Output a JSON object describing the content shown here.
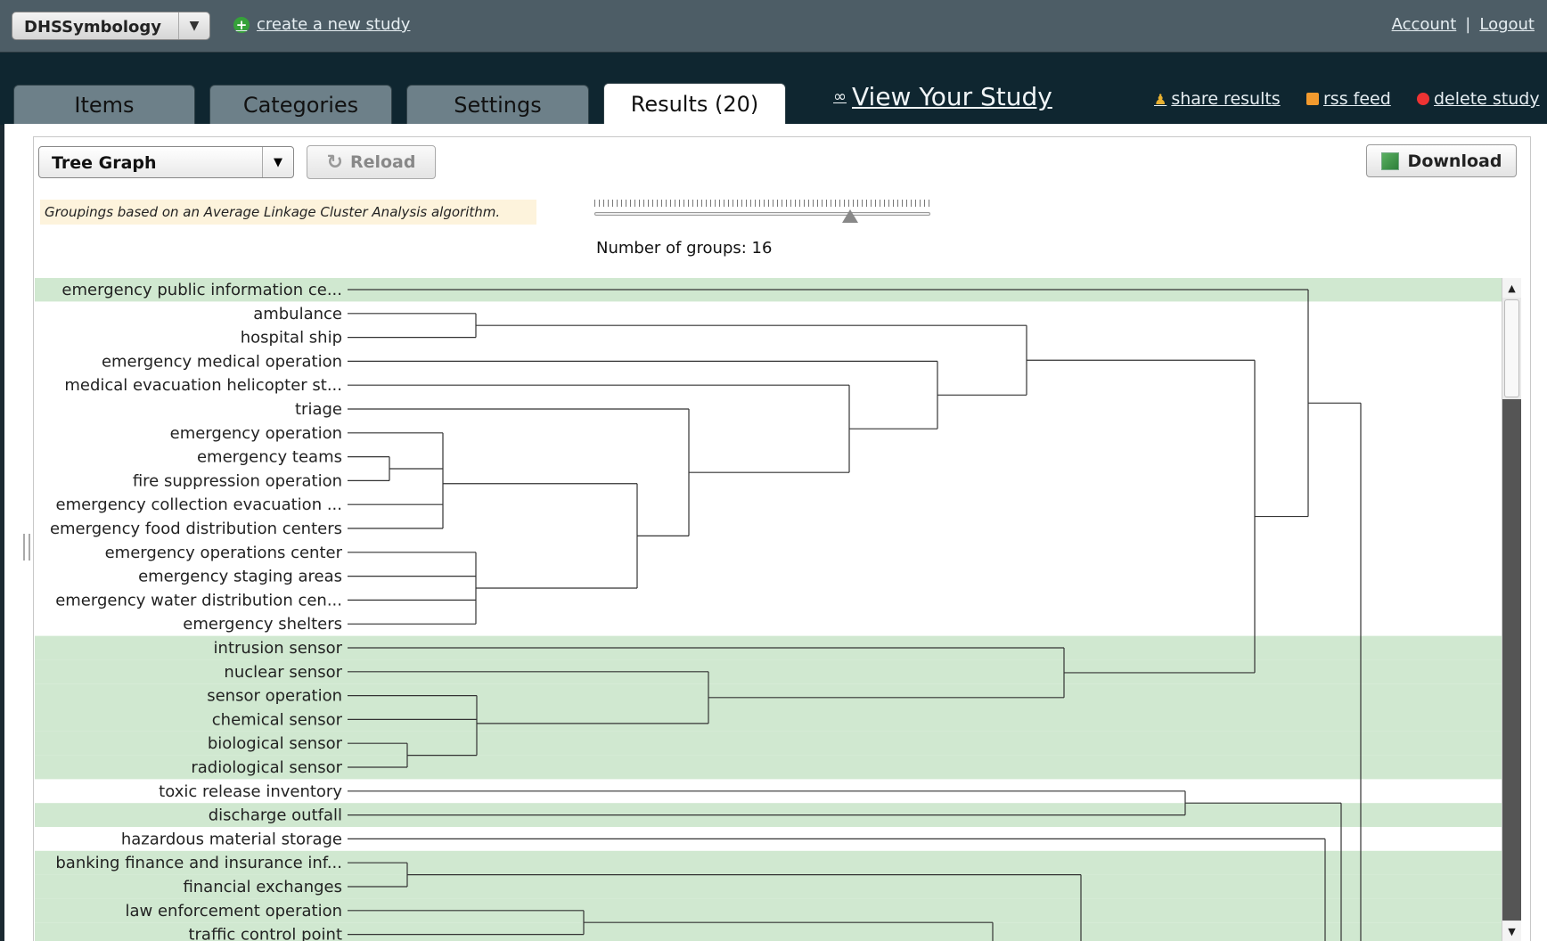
{
  "header": {
    "study_name": "DHSSymbology",
    "create_link": "create a new study",
    "account": "Account",
    "separator": "|",
    "logout": "Logout"
  },
  "tabs": [
    {
      "label": "Items"
    },
    {
      "label": "Categories"
    },
    {
      "label": "Settings"
    },
    {
      "label": "Results (20)"
    }
  ],
  "view_study": "View Your Study",
  "actions": {
    "share": "share results",
    "rss": "rss feed",
    "delete": "delete study"
  },
  "toolbar": {
    "graph_type": "Tree Graph",
    "reload": "Reload",
    "download": "Download"
  },
  "analysis_note": "Groupings based on an Average Linkage Cluster Analysis algorithm.",
  "groups": {
    "label": "Number of groups: 16",
    "value": 16,
    "slider_fraction": 0.76
  },
  "colors": {
    "highlight": "#d0e8d0",
    "topbar": "#4d5d66",
    "navband": "#0f2630"
  },
  "tree": {
    "items": [
      "emergency public information ce...",
      "ambulance",
      "hospital ship",
      "emergency medical operation",
      "medical evacuation helicopter st...",
      "triage",
      "emergency operation",
      "emergency teams",
      "fire suppression operation",
      "emergency collection evacuation ...",
      "emergency food distribution centers",
      "emergency operations center",
      "emergency staging areas",
      "emergency water distribution cen...",
      "emergency shelters",
      "intrusion sensor",
      "nuclear sensor",
      "sensor operation",
      "chemical sensor",
      "biological sensor",
      "radiological sensor",
      "toxic release inventory",
      "discharge outfall",
      "hazardous material storage",
      "banking finance and insurance inf...",
      "financial exchanges",
      "law enforcement operation",
      "traffic control point"
    ],
    "highlighted_rows": [
      0,
      15,
      16,
      17,
      18,
      19,
      20,
      22,
      24,
      25,
      26,
      27
    ]
  }
}
